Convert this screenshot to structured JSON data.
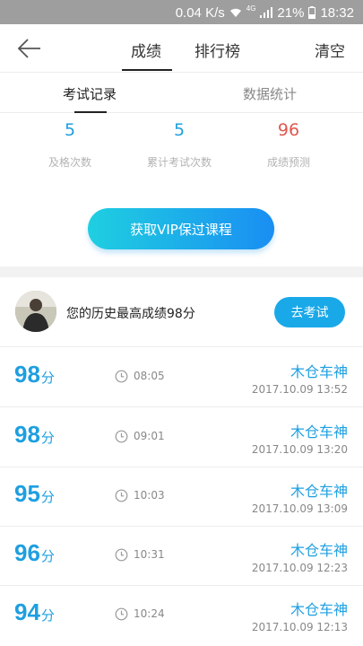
{
  "status_bar": {
    "speed": "0.04 K/s",
    "network": "4G",
    "battery": "21%",
    "time": "18:32"
  },
  "nav": {
    "back_icon": "arrow-left-icon",
    "tabs": [
      {
        "label": "成绩",
        "active": true
      },
      {
        "label": "排行榜",
        "active": false
      }
    ],
    "clear_label": "清空"
  },
  "subtabs": [
    {
      "label": "考试记录",
      "active": true
    },
    {
      "label": "数据统计",
      "active": false
    }
  ],
  "stats": [
    {
      "value": "5",
      "label": "及格次数",
      "color": "#1e9fe0"
    },
    {
      "value": "5",
      "label": "累计考试次数",
      "color": "#1e9fe0"
    },
    {
      "value": "96",
      "label": "成绩预测",
      "color": "#e0574f"
    }
  ],
  "vip_button": "获取VIP保过课程",
  "best": {
    "text": "您的历史最高成绩98分",
    "go_label": "去考试"
  },
  "records": [
    {
      "score": "98",
      "unit": "分",
      "duration": "08:05",
      "name": "木仓车神",
      "date": "2017.10.09  13:52"
    },
    {
      "score": "98",
      "unit": "分",
      "duration": "09:01",
      "name": "木仓车神",
      "date": "2017.10.09  13:20"
    },
    {
      "score": "95",
      "unit": "分",
      "duration": "10:03",
      "name": "木仓车神",
      "date": "2017.10.09  13:09"
    },
    {
      "score": "96",
      "unit": "分",
      "duration": "10:31",
      "name": "木仓车神",
      "date": "2017.10.09  12:23"
    },
    {
      "score": "94",
      "unit": "分",
      "duration": "10:24",
      "name": "木仓车神",
      "date": "2017.10.09  12:13"
    }
  ],
  "colors": {
    "accent": "#1e9fe0",
    "prediction": "#e0574f"
  }
}
